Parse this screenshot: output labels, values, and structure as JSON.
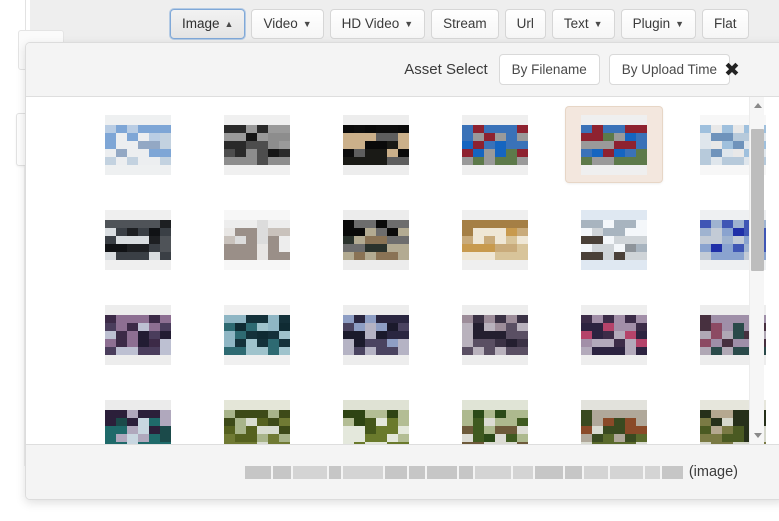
{
  "toolbar": {
    "buttons": [
      {
        "label": "Image",
        "caret": "▲",
        "active": true,
        "name": "toolbar-button-image"
      },
      {
        "label": "Video",
        "caret": "▼",
        "active": false,
        "name": "toolbar-button-video"
      },
      {
        "label": "HD Video",
        "caret": "▼",
        "active": false,
        "name": "toolbar-button-hd-video"
      },
      {
        "label": "Stream",
        "caret": "",
        "active": false,
        "name": "toolbar-button-stream"
      },
      {
        "label": "Url",
        "caret": "",
        "active": false,
        "name": "toolbar-button-url"
      },
      {
        "label": "Text",
        "caret": "▼",
        "active": false,
        "name": "toolbar-button-text"
      },
      {
        "label": "Plugin",
        "caret": "▼",
        "active": false,
        "name": "toolbar-button-plugin"
      },
      {
        "label": "Flat",
        "caret": "",
        "active": false,
        "name": "toolbar-button-flat"
      }
    ]
  },
  "dialog": {
    "title": "Asset Select",
    "sort_buttons": [
      {
        "label": "By Filename",
        "name": "sort-by-filename-button"
      },
      {
        "label": "By Upload Time",
        "name": "sort-by-upload-time-button"
      }
    ],
    "close_icon": "✖",
    "scrollbar": {
      "up_arrow": "▲",
      "down_arrow": "▼",
      "thumb_top_pct": 5,
      "thumb_height_pct": 45
    },
    "footer": {
      "filename": "",
      "filename_redacted": true,
      "file_kind": "(image)"
    },
    "grid": {
      "columns": 6,
      "selected_index": 4,
      "thumbnails": [
        {
          "id": "thumb-1",
          "palette": [
            "#eef0f1",
            "#7ea6d6",
            "#b9cde4",
            "#93a8c4",
            "#c3d2e0",
            "#eceef0"
          ]
        },
        {
          "id": "thumb-2",
          "palette": [
            "#f0f0f0",
            "#9a9a9a",
            "#2a2a2a",
            "#151515",
            "#4d4d4d",
            "#8d8d8d"
          ]
        },
        {
          "id": "thumb-3",
          "palette": [
            "#ededed",
            "#0d0d0d",
            "#0a0a0a",
            "#cbb08a",
            "#1a1a16",
            "#5e5e5e"
          ]
        },
        {
          "id": "thumb-4",
          "palette": [
            "#efefef",
            "#8e2230",
            "#3a72b8",
            "#1565c0",
            "#5d7a4a",
            "#9a9a9a"
          ]
        },
        {
          "id": "thumb-5",
          "palette": [
            "#efefef",
            "#8e2230",
            "#3a72b8",
            "#1565c0",
            "#5d7a4a",
            "#9a9a9a"
          ]
        },
        {
          "id": "thumb-6",
          "palette": [
            "#f7f7f7",
            "#e8e8e8",
            "#9fc0dd",
            "#6f93bb",
            "#b7cadb",
            "#dfe6ec"
          ]
        },
        {
          "id": "thumb-7",
          "palette": [
            "#efefef",
            "#4f5358",
            "#1d1f22",
            "#101215",
            "#3a3f45",
            "#d9dde0"
          ]
        },
        {
          "id": "thumb-8",
          "palette": [
            "#f7f7f7",
            "#ededed",
            "#dcdcdc",
            "#c9c2bc",
            "#9a8f88",
            "#e8e6e4"
          ]
        },
        {
          "id": "thumb-9",
          "palette": [
            "#ececec",
            "#6d6d6d",
            "#0a0a0a",
            "#2a322c",
            "#b3ab92",
            "#8a7355"
          ]
        },
        {
          "id": "thumb-10",
          "palette": [
            "#efefef",
            "#c9ab7b",
            "#a57f45",
            "#c89a4e",
            "#d8c49a",
            "#efe7d6"
          ]
        },
        {
          "id": "thumb-11",
          "palette": [
            "#dfe8f2",
            "#f4f7fa",
            "#a8b4bf",
            "#8e949a",
            "#4a4038",
            "#cfd4d8"
          ]
        },
        {
          "id": "thumb-12",
          "palette": [
            "#eef0f2",
            "#9fb3d0",
            "#3f56b5",
            "#1f2fa8",
            "#8aa3cf",
            "#c3cbd6"
          ]
        },
        {
          "id": "thumb-13",
          "palette": [
            "#ededed",
            "#8d6f92",
            "#3c2a47",
            "#221c33",
            "#4a3d5c",
            "#bdc0d2"
          ]
        },
        {
          "id": "thumb-14",
          "palette": [
            "#f0f0f0",
            "#8fb6c4",
            "#14313a",
            "#0f2b33",
            "#2e6a72",
            "#9fc3cc"
          ]
        },
        {
          "id": "thumb-15",
          "palette": [
            "#ededed",
            "#8e9ec4",
            "#2a2640",
            "#1b1a2c",
            "#4a4360",
            "#b5b3c4"
          ]
        },
        {
          "id": "thumb-16",
          "palette": [
            "#ededed",
            "#9d8d9a",
            "#3b3245",
            "#241f30",
            "#5a4f63",
            "#b9b2bd"
          ]
        },
        {
          "id": "thumb-17",
          "palette": [
            "#eeeeee",
            "#a28fa8",
            "#3c2c48",
            "#b5436a",
            "#2c2340",
            "#b3aabb"
          ]
        },
        {
          "id": "thumb-18",
          "palette": [
            "#ededed",
            "#9f8fa8",
            "#47303f",
            "#8c4a63",
            "#2a4a4a",
            "#b0a8b5"
          ]
        },
        {
          "id": "thumb-19",
          "palette": [
            "#ebebeb",
            "#b0a8bd",
            "#2b1f3a",
            "#1b4a4a",
            "#1f6a6a",
            "#c8d6e0"
          ]
        },
        {
          "id": "thumb-20",
          "palette": [
            "#e4e6d8",
            "#a8b48a",
            "#3d4a18",
            "#55611f",
            "#707a34",
            "#d8dcd0"
          ]
        },
        {
          "id": "thumb-21",
          "palette": [
            "#dfe2d4",
            "#b3bd94",
            "#2e4413",
            "#44561a",
            "#6a7a2c",
            "#e4e8dc"
          ]
        },
        {
          "id": "thumb-22",
          "palette": [
            "#e0e4d6",
            "#adb98e",
            "#2b4a18",
            "#3f5a20",
            "#6d5a3a",
            "#dcdcd4"
          ]
        },
        {
          "id": "thumb-23",
          "palette": [
            "#e2e2dc",
            "#b0a89a",
            "#3a4a20",
            "#8a4a28",
            "#5a6a2c",
            "#dadcd2"
          ]
        },
        {
          "id": "thumb-24",
          "palette": [
            "#e6e6dc",
            "#b5a890",
            "#26301a",
            "#4a5a22",
            "#7a7a44",
            "#d6d8cc"
          ]
        }
      ]
    }
  }
}
